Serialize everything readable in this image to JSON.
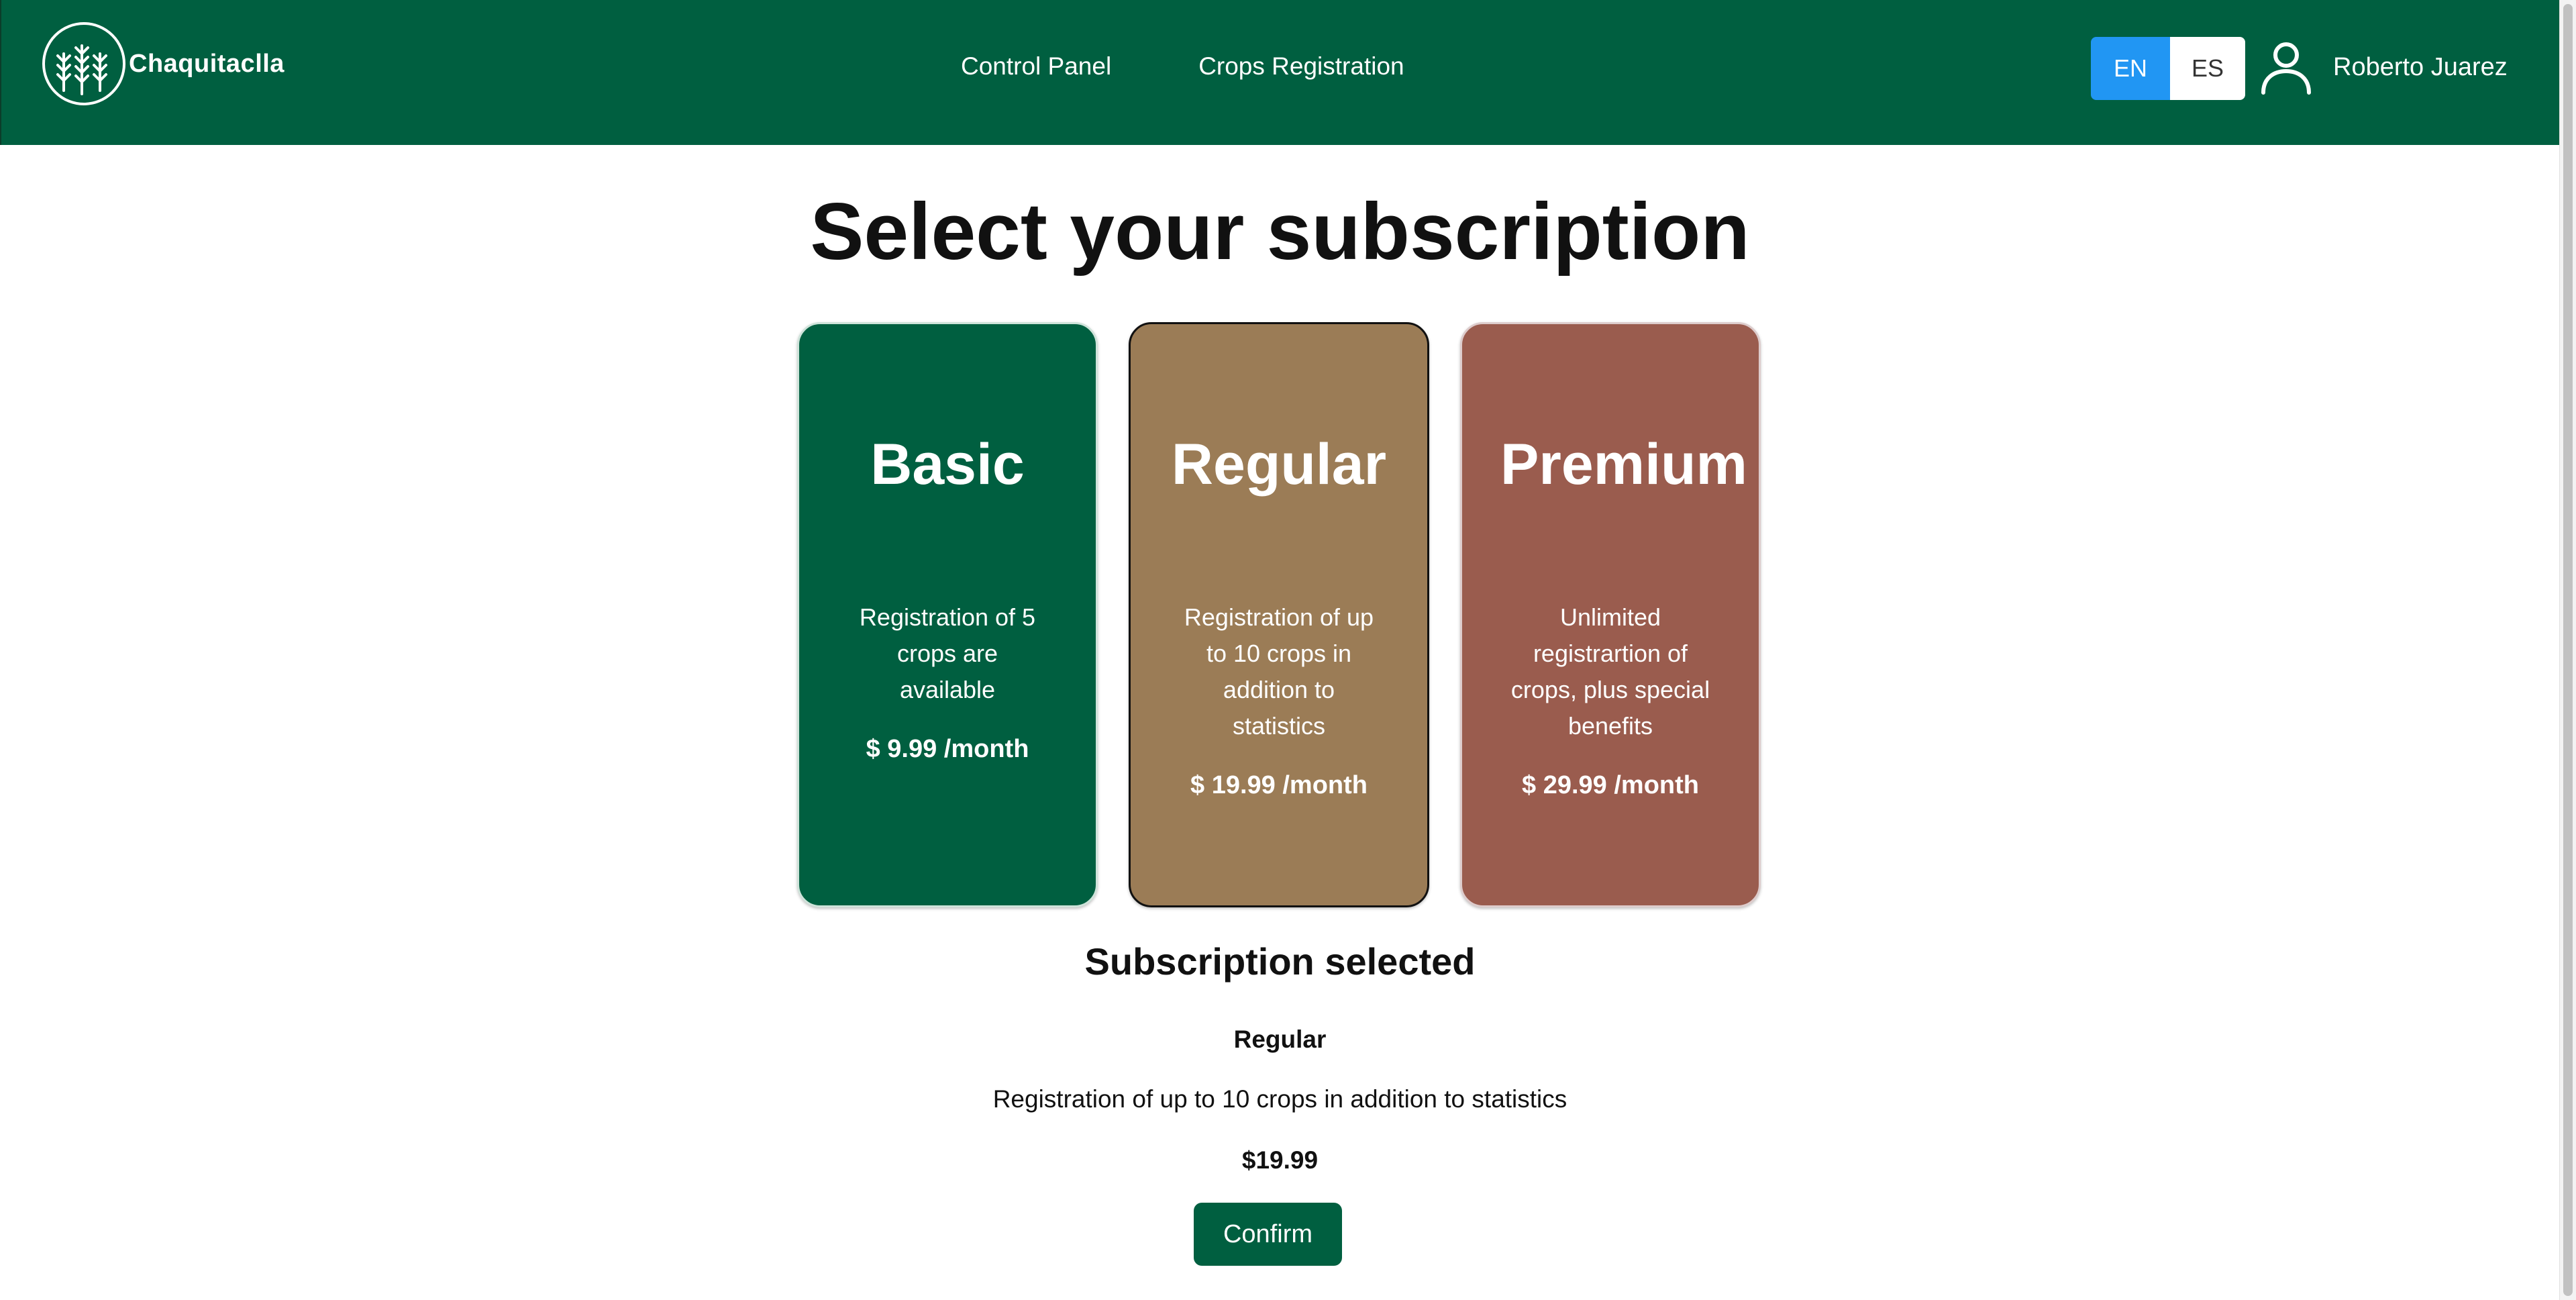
{
  "header": {
    "brand": "Chaquitaclla",
    "nav": [
      {
        "label": "Control Panel"
      },
      {
        "label": "Crops Registration"
      }
    ],
    "languages": {
      "en": "EN",
      "es": "ES",
      "active": "EN"
    },
    "user_name": "Roberto Juarez"
  },
  "main": {
    "title": "Select your subscription",
    "plans": [
      {
        "name": "Basic",
        "description": "Registration of 5 crops are available",
        "price": "$ 9.99 /month",
        "color": "#005f40"
      },
      {
        "name": "Regular",
        "description": "Registration of up to 10 crops in addition to statistics",
        "price": "$ 19.99 /month",
        "color": "#9b7c56"
      },
      {
        "name": "Premium",
        "description": "Unlimited registrartion of crops, plus special benefits",
        "price": "$ 29.99 /month",
        "color": "#9a5c4e"
      }
    ],
    "selected": {
      "heading": "Subscription selected",
      "name": "Regular",
      "description": "Registration of up to 10 crops in addition to statistics",
      "price": "$19.99",
      "confirm_label": "Confirm"
    }
  },
  "colors": {
    "primary": "#005f40",
    "accent": "#2196f3"
  }
}
